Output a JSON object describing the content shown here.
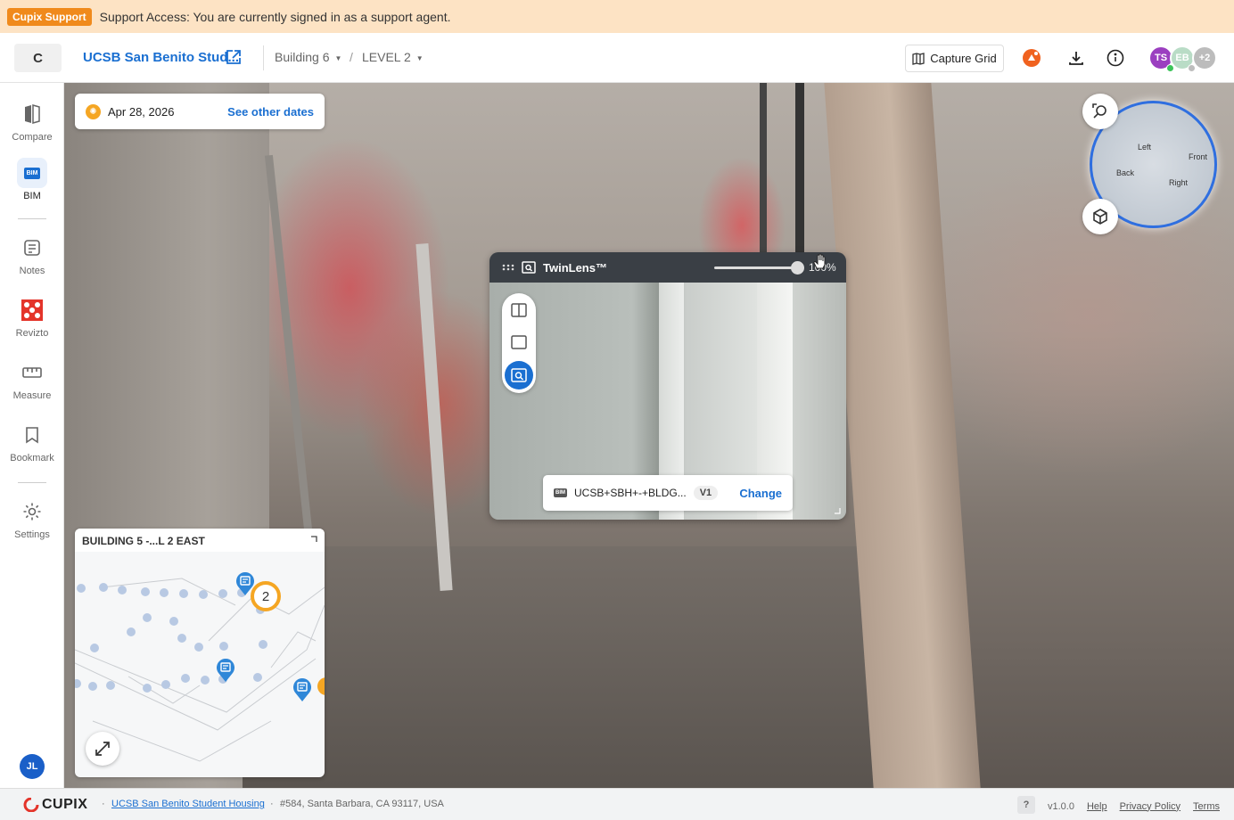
{
  "support_banner": {
    "badge": "Cupix Support",
    "message": "Support Access: You are currently signed in as a support agent."
  },
  "header": {
    "logo_letter": "C",
    "project_name": "UCSB San Benito Stud...",
    "breadcrumbs": [
      {
        "label": "Building 6"
      },
      {
        "label": "LEVEL 2"
      }
    ],
    "breadcrumb_separator": "/",
    "capture_grid_label": "Capture Grid",
    "avatars": [
      {
        "initials": "TS",
        "color": "#9b3fc0",
        "status": "#3cc45a"
      },
      {
        "initials": "EB",
        "color": "#b9dcc6",
        "status": "#bdbdbd"
      },
      {
        "initials": "+2",
        "color": "#bcbcbc"
      }
    ]
  },
  "rail": {
    "items": [
      {
        "label": "Compare"
      },
      {
        "label": "BIM",
        "icon_text": "BIM"
      },
      {
        "label": "Notes"
      },
      {
        "label": "Revizto"
      },
      {
        "label": "Measure"
      },
      {
        "label": "Bookmark"
      },
      {
        "label": "Settings"
      }
    ],
    "user_initials": "JL"
  },
  "viewer": {
    "date": "Apr 28, 2026",
    "see_other_dates": "See other dates",
    "minimap": {
      "title": "BUILDING 5 -...L 2 EAST",
      "cluster_count": "2"
    },
    "twinlens": {
      "title": "TwinLens™",
      "zoom_percent": "100%",
      "model_badge": "BIM",
      "model_name": "UCSB+SBH+-+BLDG...",
      "version": "V1",
      "change_label": "Change"
    },
    "orientation": {
      "left": "Left",
      "front": "Front",
      "back": "Back",
      "right": "Right"
    }
  },
  "footer": {
    "brand": "CUPIX",
    "project_link": "UCSB San Benito Student Housing",
    "address": "#584, Santa Barbara, CA 93117, USA",
    "help_symbol": "?",
    "version": "v1.0.0",
    "help": "Help",
    "privacy": "Privacy Policy",
    "terms": "Terms"
  },
  "colors": {
    "accent": "#1a6fd1",
    "support_banner_bg": "#fde3c4",
    "support_badge": "#f08a1c"
  }
}
